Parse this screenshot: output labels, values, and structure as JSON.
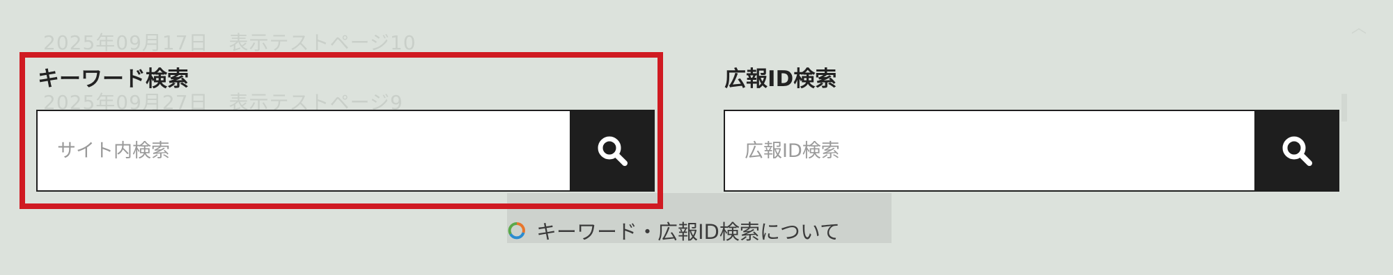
{
  "background": {
    "ghost_line_1": "2025年09月17日　表示テストページ10",
    "ghost_line_2": "2025年09月27日　表示テストページ9"
  },
  "keyword_search": {
    "title": "キーワード検索",
    "placeholder": "サイト内検索",
    "value": "",
    "button_icon": "search-icon"
  },
  "koho_id_search": {
    "title": "広報ID検索",
    "placeholder": "広報ID検索",
    "value": "",
    "button_icon": "search-icon"
  },
  "about_link": {
    "label": "キーワード・広報ID検索について",
    "icon": "ring-icon"
  },
  "colors": {
    "background": "#dce2dc",
    "button": "#1e1e1e",
    "highlight": "#d01a22",
    "ring_orange": "#e8762c",
    "ring_blue": "#2a8bd0",
    "ring_green": "#5aa84a"
  }
}
